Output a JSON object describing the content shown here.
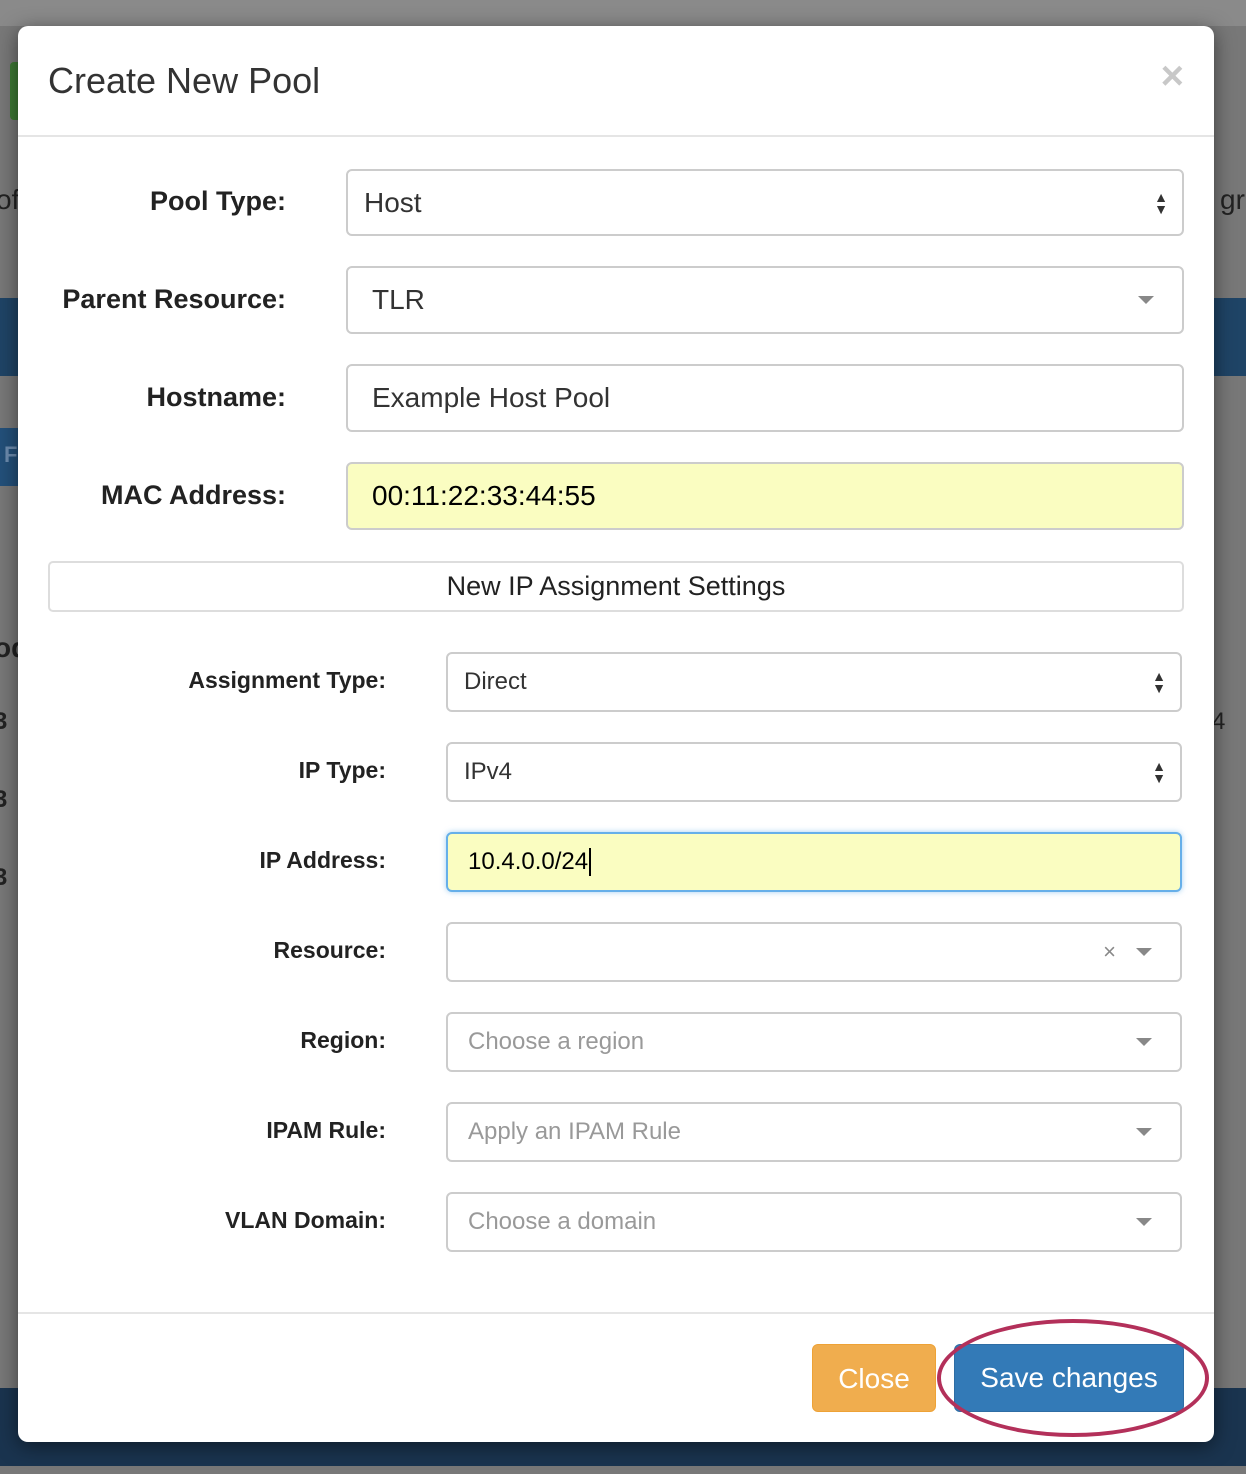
{
  "background": {
    "fragments": [
      "of",
      "gr",
      "F",
      "od",
      "3",
      "3",
      "3",
      "4"
    ]
  },
  "modal": {
    "title": "Create New Pool",
    "close_icon": "×",
    "fields": {
      "pool_type": {
        "label": "Pool Type:",
        "value": "Host"
      },
      "parent_resource": {
        "label": "Parent Resource:",
        "value": "TLR"
      },
      "hostname": {
        "label": "Hostname:",
        "value": "Example Host Pool"
      },
      "mac_address": {
        "label": "MAC Address:",
        "value": "00:11:22:33:44:55"
      }
    },
    "section_title": "New IP Assignment Settings",
    "ip_fields": {
      "assignment_type": {
        "label": "Assignment Type:",
        "value": "Direct"
      },
      "ip_type": {
        "label": "IP Type:",
        "value": "IPv4"
      },
      "ip_address": {
        "label": "IP Address:",
        "value": "10.4.0.0/24"
      },
      "resource": {
        "label": "Resource:",
        "value": ""
      },
      "region": {
        "label": "Region:",
        "placeholder": "Choose a region"
      },
      "ipam_rule": {
        "label": "IPAM Rule:",
        "placeholder": "Apply an IPAM Rule"
      },
      "vlan_domain": {
        "label": "VLAN Domain:",
        "placeholder": "Choose a domain"
      }
    },
    "buttons": {
      "close": "Close",
      "save": "Save changes"
    },
    "colors": {
      "close_button": "#f0ad4e",
      "save_button": "#337ab7",
      "highlight_ellipse": "#b3305a",
      "autofill": "#fafdc1"
    }
  }
}
